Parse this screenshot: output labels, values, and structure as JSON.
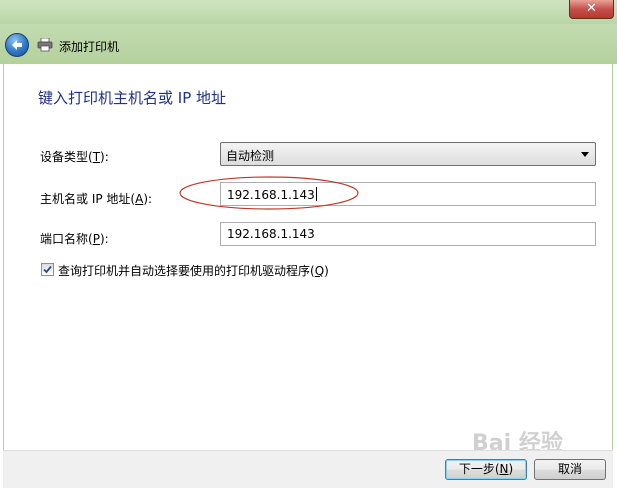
{
  "window": {
    "close_glyph": "✕"
  },
  "nav": {
    "title": "添加打印机"
  },
  "heading": "键入打印机主机名或 IP 地址",
  "fields": {
    "device_type": {
      "label_prefix": "设备类型(",
      "accel": "T",
      "label_suffix": "):",
      "value": "自动检测"
    },
    "host": {
      "label_prefix": "主机名或 IP 地址(",
      "accel": "A",
      "label_suffix": "):",
      "value": "192.168.1.143"
    },
    "port": {
      "label_prefix": "端口名称(",
      "accel": "P",
      "label_suffix": "):",
      "value": "192.168.1.143"
    }
  },
  "query_driver": {
    "checked": true,
    "label_prefix": "查询打印机并自动选择要使用的打印机驱动程序(",
    "accel": "Q",
    "label_suffix": ")"
  },
  "buttons": {
    "next_prefix": "下一步(",
    "next_accel": "N",
    "next_suffix": ")",
    "cancel": "取消"
  },
  "watermark": "Bai 经验",
  "colors": {
    "heading": "#1e3287",
    "annotation": "#c0392b"
  }
}
